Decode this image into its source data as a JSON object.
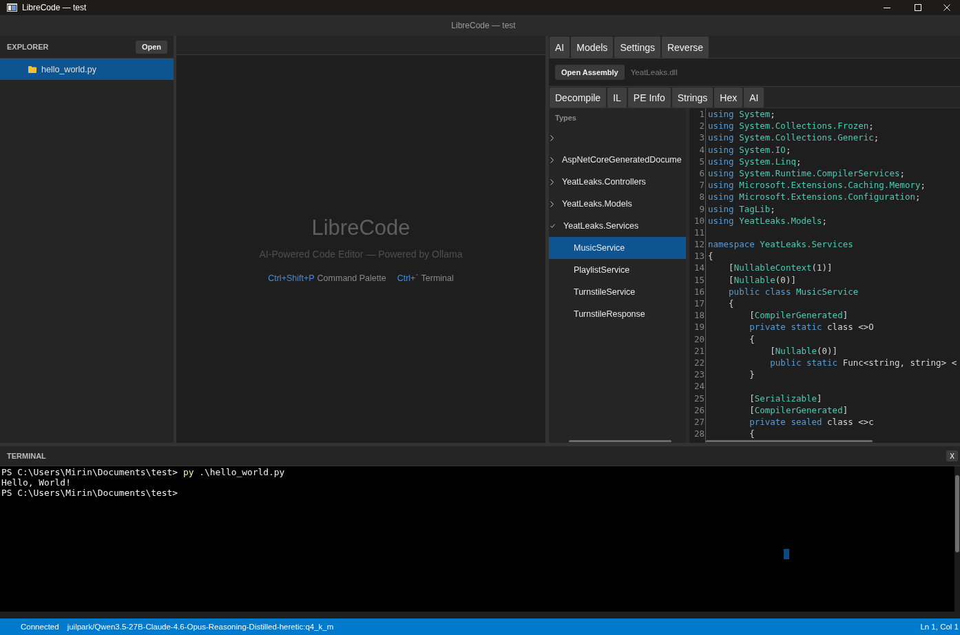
{
  "window": {
    "title": "LibreCode — test"
  },
  "header": {
    "title": "LibreCode — test"
  },
  "explorer": {
    "title": "EXPLORER",
    "open_button": "Open",
    "items": [
      {
        "name": "hello_world.py",
        "selected": true
      }
    ]
  },
  "editor": {
    "welcome": {
      "title": "LibreCode",
      "subtitle": "AI-Powered Code Editor — Powered by Ollama",
      "shortcuts": [
        {
          "keys": "Ctrl+Shift+P",
          "action": "Command Palette"
        },
        {
          "keys": "Ctrl+`",
          "action": "Terminal"
        }
      ]
    }
  },
  "side_panel": {
    "tabs": [
      "AI",
      "Models",
      "Settings",
      "Reverse"
    ],
    "open_button": "Open Assembly",
    "assembly": "YeatLeaks.dll",
    "view_tabs": [
      "Decompile",
      "IL",
      "PE Info",
      "Strings",
      "Hex",
      "AI"
    ],
    "types": {
      "title": "Types",
      "items": [
        {
          "expanded": false,
          "selected": false
        },
        {
          "label": "AspNetCoreGeneratedDocume",
          "expanded": false,
          "selected": false
        },
        {
          "label": "YeatLeaks.Controllers",
          "expanded": false,
          "selected": false
        },
        {
          "label": "YeatLeaks.Models",
          "expanded": false,
          "selected": false
        },
        {
          "label": "YeatLeaks.Services",
          "expanded": true,
          "selected": false,
          "children": [
            {
              "label": "MusicService",
              "selected": true
            },
            {
              "label": "PlaylistService",
              "selected": false
            },
            {
              "label": "TurnstileService",
              "selected": false
            },
            {
              "label": "TurnstileResponse",
              "selected": false
            }
          ]
        }
      ]
    },
    "code": {
      "lines": [
        {
          "number": "1",
          "tokens": [
            {
              "text": "using ",
              "kind": "keyword"
            },
            {
              "text": "System",
              "kind": "type"
            },
            {
              "text": ";",
              "kind": "plain"
            }
          ]
        },
        {
          "number": "2",
          "tokens": [
            {
              "text": "using ",
              "kind": "keyword"
            },
            {
              "text": "System.Collections.Frozen",
              "kind": "type"
            },
            {
              "text": ";",
              "kind": "plain"
            }
          ]
        },
        {
          "number": "3",
          "tokens": [
            {
              "text": "using ",
              "kind": "keyword"
            },
            {
              "text": "System.Collections.Generic",
              "kind": "type"
            },
            {
              "text": ";",
              "kind": "plain"
            }
          ]
        },
        {
          "number": "4",
          "tokens": [
            {
              "text": "using ",
              "kind": "keyword"
            },
            {
              "text": "System.IO",
              "kind": "type"
            },
            {
              "text": ";",
              "kind": "plain"
            }
          ]
        },
        {
          "number": "5",
          "tokens": [
            {
              "text": "using ",
              "kind": "keyword"
            },
            {
              "text": "System.Linq",
              "kind": "type"
            },
            {
              "text": ";",
              "kind": "plain"
            }
          ]
        },
        {
          "number": "6",
          "tokens": [
            {
              "text": "using ",
              "kind": "keyword"
            },
            {
              "text": "System.Runtime.CompilerServices",
              "kind": "type"
            },
            {
              "text": ";",
              "kind": "plain"
            }
          ]
        },
        {
          "number": "7",
          "tokens": [
            {
              "text": "using ",
              "kind": "keyword"
            },
            {
              "text": "Microsoft.Extensions.Caching.Memory",
              "kind": "type"
            },
            {
              "text": ";",
              "kind": "plain"
            }
          ]
        },
        {
          "number": "8",
          "tokens": [
            {
              "text": "using ",
              "kind": "keyword"
            },
            {
              "text": "Microsoft.Extensions.Configuration",
              "kind": "type"
            },
            {
              "text": ";",
              "kind": "plain"
            }
          ]
        },
        {
          "number": "9",
          "tokens": [
            {
              "text": "using ",
              "kind": "keyword"
            },
            {
              "text": "TagLib",
              "kind": "type"
            },
            {
              "text": ";",
              "kind": "plain"
            }
          ]
        },
        {
          "number": "10",
          "tokens": [
            {
              "text": "using ",
              "kind": "keyword"
            },
            {
              "text": "YeatLeaks.Models",
              "kind": "type"
            },
            {
              "text": ";",
              "kind": "plain"
            }
          ]
        },
        {
          "number": "11"
        },
        {
          "number": "12",
          "tokens": [
            {
              "text": "namespace ",
              "kind": "keyword"
            },
            {
              "text": "YeatLeaks.Services",
              "kind": "type"
            }
          ]
        },
        {
          "number": "13",
          "tokens": [
            {
              "text": "{",
              "kind": "plain"
            }
          ]
        },
        {
          "number": "14",
          "tokens": [
            {
              "text": "    [",
              "kind": "plain"
            },
            {
              "text": "NullableContext",
              "kind": "type"
            },
            {
              "text": "(1)]",
              "kind": "plain"
            }
          ]
        },
        {
          "number": "15",
          "tokens": [
            {
              "text": "    [",
              "kind": "plain"
            },
            {
              "text": "Nullable",
              "kind": "type"
            },
            {
              "text": "(0)]",
              "kind": "plain"
            }
          ]
        },
        {
          "number": "16",
          "tokens": [
            {
              "text": "    public class ",
              "kind": "keyword"
            },
            {
              "text": "MusicService",
              "kind": "type"
            }
          ]
        },
        {
          "number": "17",
          "tokens": [
            {
              "text": "    {",
              "kind": "plain"
            }
          ]
        },
        {
          "number": "18",
          "tokens": [
            {
              "text": "        [",
              "kind": "plain"
            },
            {
              "text": "CompilerGenerated",
              "kind": "type"
            },
            {
              "text": "]",
              "kind": "plain"
            }
          ]
        },
        {
          "number": "19",
          "tokens": [
            {
              "text": "        private static ",
              "kind": "keyword"
            },
            {
              "text": "class <>O",
              "kind": "plain"
            }
          ]
        },
        {
          "number": "20",
          "tokens": [
            {
              "text": "        {",
              "kind": "plain"
            }
          ]
        },
        {
          "number": "21",
          "tokens": [
            {
              "text": "            [",
              "kind": "plain"
            },
            {
              "text": "Nullable",
              "kind": "type"
            },
            {
              "text": "(0)]",
              "kind": "plain"
            }
          ]
        },
        {
          "number": "22",
          "tokens": [
            {
              "text": "            public static ",
              "kind": "keyword"
            },
            {
              "text": "Func<string, string> <",
              "kind": "plain"
            }
          ]
        },
        {
          "number": "23",
          "tokens": [
            {
              "text": "        }",
              "kind": "plain"
            }
          ]
        },
        {
          "number": "24"
        },
        {
          "number": "25",
          "tokens": [
            {
              "text": "        [",
              "kind": "plain"
            },
            {
              "text": "Serializable",
              "kind": "type"
            },
            {
              "text": "]",
              "kind": "plain"
            }
          ]
        },
        {
          "number": "26",
          "tokens": [
            {
              "text": "        [",
              "kind": "plain"
            },
            {
              "text": "CompilerGenerated",
              "kind": "type"
            },
            {
              "text": "]",
              "kind": "plain"
            }
          ]
        },
        {
          "number": "27",
          "tokens": [
            {
              "text": "        private sealed ",
              "kind": "keyword"
            },
            {
              "text": "class <>c",
              "kind": "plain"
            }
          ]
        },
        {
          "number": "28",
          "tokens": [
            {
              "text": "        {",
              "kind": "plain"
            }
          ]
        }
      ]
    }
  },
  "terminal": {
    "title": "TERMINAL",
    "close_button": "X",
    "lines": [
      {
        "tokens": [
          {
            "text": "PS C:\\Users\\Mirin\\Documents\\test> ",
            "kind": "plain"
          },
          {
            "text": "py",
            "kind": "command"
          },
          {
            "text": " .\\hello_world.py",
            "kind": "plain"
          }
        ]
      },
      {
        "tokens": [
          {
            "text": "Hello, World!",
            "kind": "plain"
          }
        ]
      },
      {
        "tokens": [
          {
            "text": "PS C:\\Users\\Mirin\\Documents\\test>",
            "kind": "plain"
          }
        ]
      }
    ]
  },
  "status_bar": {
    "connection": "Connected",
    "model": "juilpark/Qwen3.5-27B-Claude-4.6-Opus-Reasoning-Distilled-heretic:q4_k_m",
    "position": "Ln 1, Col 1"
  }
}
